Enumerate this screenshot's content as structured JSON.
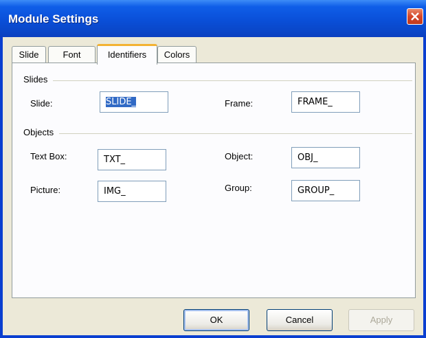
{
  "window": {
    "title": "Module Settings"
  },
  "tabs": [
    {
      "label": "Slide",
      "active": false
    },
    {
      "label": "Font",
      "active": false
    },
    {
      "label": "Identifiers",
      "active": true
    },
    {
      "label": "Colors",
      "active": false
    }
  ],
  "groups": {
    "slides": {
      "label": "Slides"
    },
    "objects": {
      "label": "Objects"
    }
  },
  "fields": {
    "slide": {
      "label": "Slide:",
      "value": "SLIDE_"
    },
    "frame": {
      "label": "Frame:",
      "value": "FRAME_"
    },
    "text_box": {
      "label": "Text Box:",
      "value": "TXT_"
    },
    "object": {
      "label": "Object:",
      "value": "OBJ_"
    },
    "picture": {
      "label": "Picture:",
      "value": "IMG_"
    },
    "group": {
      "label": "Group:",
      "value": "GROUP_"
    }
  },
  "buttons": {
    "ok": "OK",
    "cancel": "Cancel",
    "apply": "Apply"
  },
  "colors": {
    "titlebar": "#0a4fd8",
    "client": "#ece9d8",
    "active_tab_highlight": "#f3b233",
    "selection": "#316ac5"
  }
}
